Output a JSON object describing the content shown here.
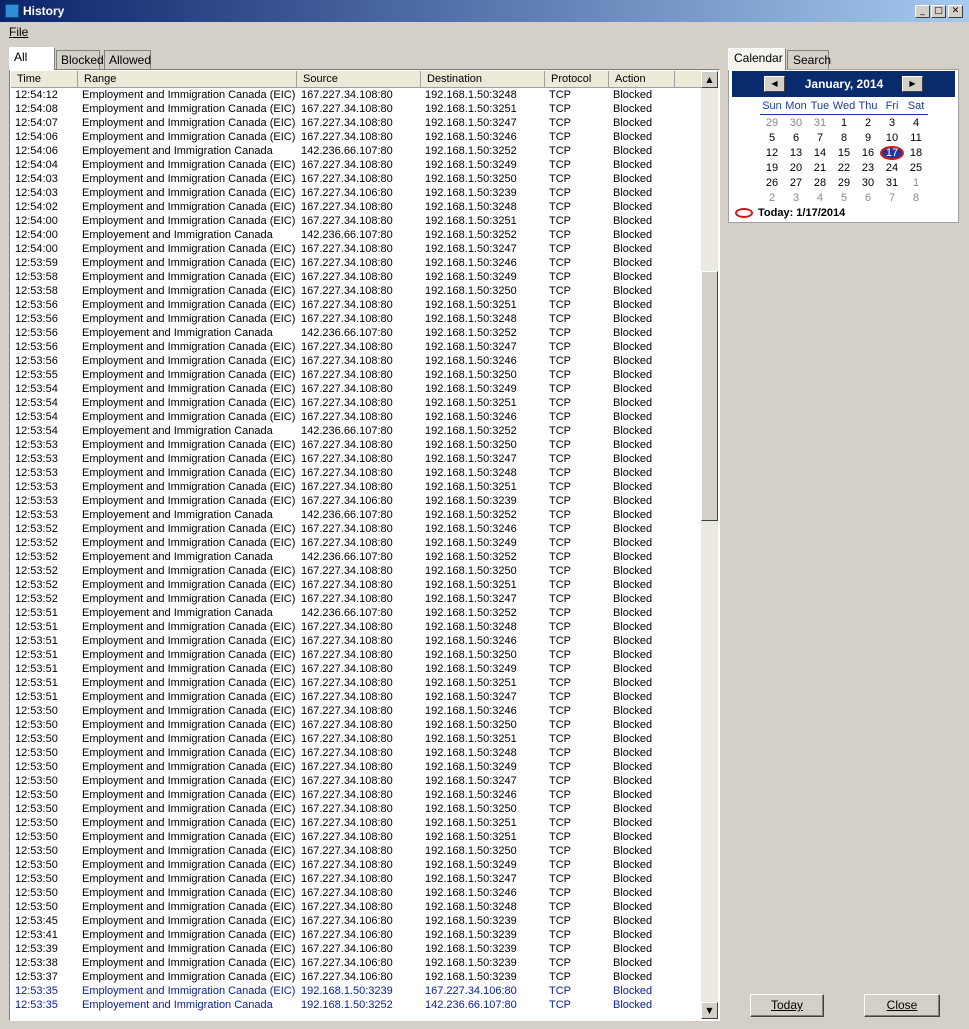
{
  "window": {
    "title": "History"
  },
  "menu": {
    "file": "File"
  },
  "tabs": [
    {
      "label": "All"
    },
    {
      "label": "Blocked"
    },
    {
      "label": "Allowed"
    }
  ],
  "columns": [
    "Time",
    "Range",
    "Source",
    "Destination",
    "Protocol",
    "Action"
  ],
  "rows": [
    {
      "time": "12:54:12",
      "range": "Employment and Immigration Canada (EIC)",
      "source": "167.227.34.108:80",
      "destination": "192.168.1.50:3248",
      "protocol": "TCP",
      "action": "Blocked"
    },
    {
      "time": "12:54:08",
      "range": "Employment and Immigration Canada (EIC)",
      "source": "167.227.34.108:80",
      "destination": "192.168.1.50:3251",
      "protocol": "TCP",
      "action": "Blocked"
    },
    {
      "time": "12:54:07",
      "range": "Employment and Immigration Canada (EIC)",
      "source": "167.227.34.108:80",
      "destination": "192.168.1.50:3247",
      "protocol": "TCP",
      "action": "Blocked"
    },
    {
      "time": "12:54:06",
      "range": "Employment and Immigration Canada (EIC)",
      "source": "167.227.34.108:80",
      "destination": "192.168.1.50:3246",
      "protocol": "TCP",
      "action": "Blocked"
    },
    {
      "time": "12:54:06",
      "range": "Employement and Immigration Canada",
      "source": "142.236.66.107:80",
      "destination": "192.168.1.50:3252",
      "protocol": "TCP",
      "action": "Blocked"
    },
    {
      "time": "12:54:04",
      "range": "Employment and Immigration Canada (EIC)",
      "source": "167.227.34.108:80",
      "destination": "192.168.1.50:3249",
      "protocol": "TCP",
      "action": "Blocked"
    },
    {
      "time": "12:54:03",
      "range": "Employment and Immigration Canada (EIC)",
      "source": "167.227.34.108:80",
      "destination": "192.168.1.50:3250",
      "protocol": "TCP",
      "action": "Blocked"
    },
    {
      "time": "12:54:03",
      "range": "Employment and Immigration Canada (EIC)",
      "source": "167.227.34.106:80",
      "destination": "192.168.1.50:3239",
      "protocol": "TCP",
      "action": "Blocked"
    },
    {
      "time": "12:54:02",
      "range": "Employment and Immigration Canada (EIC)",
      "source": "167.227.34.108:80",
      "destination": "192.168.1.50:3248",
      "protocol": "TCP",
      "action": "Blocked"
    },
    {
      "time": "12:54:00",
      "range": "Employment and Immigration Canada (EIC)",
      "source": "167.227.34.108:80",
      "destination": "192.168.1.50:3251",
      "protocol": "TCP",
      "action": "Blocked"
    },
    {
      "time": "12:54:00",
      "range": "Employement and Immigration Canada",
      "source": "142.236.66.107:80",
      "destination": "192.168.1.50:3252",
      "protocol": "TCP",
      "action": "Blocked"
    },
    {
      "time": "12:54:00",
      "range": "Employment and Immigration Canada (EIC)",
      "source": "167.227.34.108:80",
      "destination": "192.168.1.50:3247",
      "protocol": "TCP",
      "action": "Blocked"
    },
    {
      "time": "12:53:59",
      "range": "Employment and Immigration Canada (EIC)",
      "source": "167.227.34.108:80",
      "destination": "192.168.1.50:3246",
      "protocol": "TCP",
      "action": "Blocked"
    },
    {
      "time": "12:53:58",
      "range": "Employment and Immigration Canada (EIC)",
      "source": "167.227.34.108:80",
      "destination": "192.168.1.50:3249",
      "protocol": "TCP",
      "action": "Blocked"
    },
    {
      "time": "12:53:58",
      "range": "Employment and Immigration Canada (EIC)",
      "source": "167.227.34.108:80",
      "destination": "192.168.1.50:3250",
      "protocol": "TCP",
      "action": "Blocked"
    },
    {
      "time": "12:53:56",
      "range": "Employment and Immigration Canada (EIC)",
      "source": "167.227.34.108:80",
      "destination": "192.168.1.50:3251",
      "protocol": "TCP",
      "action": "Blocked"
    },
    {
      "time": "12:53:56",
      "range": "Employment and Immigration Canada (EIC)",
      "source": "167.227.34.108:80",
      "destination": "192.168.1.50:3248",
      "protocol": "TCP",
      "action": "Blocked"
    },
    {
      "time": "12:53:56",
      "range": "Employement and Immigration Canada",
      "source": "142.236.66.107:80",
      "destination": "192.168.1.50:3252",
      "protocol": "TCP",
      "action": "Blocked"
    },
    {
      "time": "12:53:56",
      "range": "Employment and Immigration Canada (EIC)",
      "source": "167.227.34.108:80",
      "destination": "192.168.1.50:3247",
      "protocol": "TCP",
      "action": "Blocked"
    },
    {
      "time": "12:53:56",
      "range": "Employment and Immigration Canada (EIC)",
      "source": "167.227.34.108:80",
      "destination": "192.168.1.50:3246",
      "protocol": "TCP",
      "action": "Blocked"
    },
    {
      "time": "12:53:55",
      "range": "Employment and Immigration Canada (EIC)",
      "source": "167.227.34.108:80",
      "destination": "192.168.1.50:3250",
      "protocol": "TCP",
      "action": "Blocked"
    },
    {
      "time": "12:53:54",
      "range": "Employment and Immigration Canada (EIC)",
      "source": "167.227.34.108:80",
      "destination": "192.168.1.50:3249",
      "protocol": "TCP",
      "action": "Blocked"
    },
    {
      "time": "12:53:54",
      "range": "Employment and Immigration Canada (EIC)",
      "source": "167.227.34.108:80",
      "destination": "192.168.1.50:3251",
      "protocol": "TCP",
      "action": "Blocked"
    },
    {
      "time": "12:53:54",
      "range": "Employment and Immigration Canada (EIC)",
      "source": "167.227.34.108:80",
      "destination": "192.168.1.50:3246",
      "protocol": "TCP",
      "action": "Blocked"
    },
    {
      "time": "12:53:54",
      "range": "Employement and Immigration Canada",
      "source": "142.236.66.107:80",
      "destination": "192.168.1.50:3252",
      "protocol": "TCP",
      "action": "Blocked"
    },
    {
      "time": "12:53:53",
      "range": "Employment and Immigration Canada (EIC)",
      "source": "167.227.34.108:80",
      "destination": "192.168.1.50:3250",
      "protocol": "TCP",
      "action": "Blocked"
    },
    {
      "time": "12:53:53",
      "range": "Employment and Immigration Canada (EIC)",
      "source": "167.227.34.108:80",
      "destination": "192.168.1.50:3247",
      "protocol": "TCP",
      "action": "Blocked"
    },
    {
      "time": "12:53:53",
      "range": "Employment and Immigration Canada (EIC)",
      "source": "167.227.34.108:80",
      "destination": "192.168.1.50:3248",
      "protocol": "TCP",
      "action": "Blocked"
    },
    {
      "time": "12:53:53",
      "range": "Employment and Immigration Canada (EIC)",
      "source": "167.227.34.108:80",
      "destination": "192.168.1.50:3251",
      "protocol": "TCP",
      "action": "Blocked"
    },
    {
      "time": "12:53:53",
      "range": "Employment and Immigration Canada (EIC)",
      "source": "167.227.34.106:80",
      "destination": "192.168.1.50:3239",
      "protocol": "TCP",
      "action": "Blocked"
    },
    {
      "time": "12:53:53",
      "range": "Employement and Immigration Canada",
      "source": "142.236.66.107:80",
      "destination": "192.168.1.50:3252",
      "protocol": "TCP",
      "action": "Blocked"
    },
    {
      "time": "12:53:52",
      "range": "Employment and Immigration Canada (EIC)",
      "source": "167.227.34.108:80",
      "destination": "192.168.1.50:3246",
      "protocol": "TCP",
      "action": "Blocked"
    },
    {
      "time": "12:53:52",
      "range": "Employment and Immigration Canada (EIC)",
      "source": "167.227.34.108:80",
      "destination": "192.168.1.50:3249",
      "protocol": "TCP",
      "action": "Blocked"
    },
    {
      "time": "12:53:52",
      "range": "Employement and Immigration Canada",
      "source": "142.236.66.107:80",
      "destination": "192.168.1.50:3252",
      "protocol": "TCP",
      "action": "Blocked"
    },
    {
      "time": "12:53:52",
      "range": "Employment and Immigration Canada (EIC)",
      "source": "167.227.34.108:80",
      "destination": "192.168.1.50:3250",
      "protocol": "TCP",
      "action": "Blocked"
    },
    {
      "time": "12:53:52",
      "range": "Employment and Immigration Canada (EIC)",
      "source": "167.227.34.108:80",
      "destination": "192.168.1.50:3251",
      "protocol": "TCP",
      "action": "Blocked"
    },
    {
      "time": "12:53:52",
      "range": "Employment and Immigration Canada (EIC)",
      "source": "167.227.34.108:80",
      "destination": "192.168.1.50:3247",
      "protocol": "TCP",
      "action": "Blocked"
    },
    {
      "time": "12:53:51",
      "range": "Employement and Immigration Canada",
      "source": "142.236.66.107:80",
      "destination": "192.168.1.50:3252",
      "protocol": "TCP",
      "action": "Blocked"
    },
    {
      "time": "12:53:51",
      "range": "Employment and Immigration Canada (EIC)",
      "source": "167.227.34.108:80",
      "destination": "192.168.1.50:3248",
      "protocol": "TCP",
      "action": "Blocked"
    },
    {
      "time": "12:53:51",
      "range": "Employment and Immigration Canada (EIC)",
      "source": "167.227.34.108:80",
      "destination": "192.168.1.50:3246",
      "protocol": "TCP",
      "action": "Blocked"
    },
    {
      "time": "12:53:51",
      "range": "Employment and Immigration Canada (EIC)",
      "source": "167.227.34.108:80",
      "destination": "192.168.1.50:3250",
      "protocol": "TCP",
      "action": "Blocked"
    },
    {
      "time": "12:53:51",
      "range": "Employment and Immigration Canada (EIC)",
      "source": "167.227.34.108:80",
      "destination": "192.168.1.50:3249",
      "protocol": "TCP",
      "action": "Blocked"
    },
    {
      "time": "12:53:51",
      "range": "Employment and Immigration Canada (EIC)",
      "source": "167.227.34.108:80",
      "destination": "192.168.1.50:3251",
      "protocol": "TCP",
      "action": "Blocked"
    },
    {
      "time": "12:53:51",
      "range": "Employment and Immigration Canada (EIC)",
      "source": "167.227.34.108:80",
      "destination": "192.168.1.50:3247",
      "protocol": "TCP",
      "action": "Blocked"
    },
    {
      "time": "12:53:50",
      "range": "Employment and Immigration Canada (EIC)",
      "source": "167.227.34.108:80",
      "destination": "192.168.1.50:3246",
      "protocol": "TCP",
      "action": "Blocked"
    },
    {
      "time": "12:53:50",
      "range": "Employment and Immigration Canada (EIC)",
      "source": "167.227.34.108:80",
      "destination": "192.168.1.50:3250",
      "protocol": "TCP",
      "action": "Blocked"
    },
    {
      "time": "12:53:50",
      "range": "Employment and Immigration Canada (EIC)",
      "source": "167.227.34.108:80",
      "destination": "192.168.1.50:3251",
      "protocol": "TCP",
      "action": "Blocked"
    },
    {
      "time": "12:53:50",
      "range": "Employment and Immigration Canada (EIC)",
      "source": "167.227.34.108:80",
      "destination": "192.168.1.50:3248",
      "protocol": "TCP",
      "action": "Blocked"
    },
    {
      "time": "12:53:50",
      "range": "Employment and Immigration Canada (EIC)",
      "source": "167.227.34.108:80",
      "destination": "192.168.1.50:3249",
      "protocol": "TCP",
      "action": "Blocked"
    },
    {
      "time": "12:53:50",
      "range": "Employment and Immigration Canada (EIC)",
      "source": "167.227.34.108:80",
      "destination": "192.168.1.50:3247",
      "protocol": "TCP",
      "action": "Blocked"
    },
    {
      "time": "12:53:50",
      "range": "Employment and Immigration Canada (EIC)",
      "source": "167.227.34.108:80",
      "destination": "192.168.1.50:3246",
      "protocol": "TCP",
      "action": "Blocked"
    },
    {
      "time": "12:53:50",
      "range": "Employment and Immigration Canada (EIC)",
      "source": "167.227.34.108:80",
      "destination": "192.168.1.50:3250",
      "protocol": "TCP",
      "action": "Blocked"
    },
    {
      "time": "12:53:50",
      "range": "Employment and Immigration Canada (EIC)",
      "source": "167.227.34.108:80",
      "destination": "192.168.1.50:3251",
      "protocol": "TCP",
      "action": "Blocked"
    },
    {
      "time": "12:53:50",
      "range": "Employment and Immigration Canada (EIC)",
      "source": "167.227.34.108:80",
      "destination": "192.168.1.50:3251",
      "protocol": "TCP",
      "action": "Blocked"
    },
    {
      "time": "12:53:50",
      "range": "Employment and Immigration Canada (EIC)",
      "source": "167.227.34.108:80",
      "destination": "192.168.1.50:3250",
      "protocol": "TCP",
      "action": "Blocked"
    },
    {
      "time": "12:53:50",
      "range": "Employment and Immigration Canada (EIC)",
      "source": "167.227.34.108:80",
      "destination": "192.168.1.50:3249",
      "protocol": "TCP",
      "action": "Blocked"
    },
    {
      "time": "12:53:50",
      "range": "Employment and Immigration Canada (EIC)",
      "source": "167.227.34.108:80",
      "destination": "192.168.1.50:3247",
      "protocol": "TCP",
      "action": "Blocked"
    },
    {
      "time": "12:53:50",
      "range": "Employment and Immigration Canada (EIC)",
      "source": "167.227.34.108:80",
      "destination": "192.168.1.50:3246",
      "protocol": "TCP",
      "action": "Blocked"
    },
    {
      "time": "12:53:50",
      "range": "Employment and Immigration Canada (EIC)",
      "source": "167.227.34.108:80",
      "destination": "192.168.1.50:3248",
      "protocol": "TCP",
      "action": "Blocked"
    },
    {
      "time": "12:53:45",
      "range": "Employment and Immigration Canada (EIC)",
      "source": "167.227.34.106:80",
      "destination": "192.168.1.50:3239",
      "protocol": "TCP",
      "action": "Blocked"
    },
    {
      "time": "12:53:41",
      "range": "Employment and Immigration Canada (EIC)",
      "source": "167.227.34.106:80",
      "destination": "192.168.1.50:3239",
      "protocol": "TCP",
      "action": "Blocked"
    },
    {
      "time": "12:53:39",
      "range": "Employment and Immigration Canada (EIC)",
      "source": "167.227.34.106:80",
      "destination": "192.168.1.50:3239",
      "protocol": "TCP",
      "action": "Blocked"
    },
    {
      "time": "12:53:38",
      "range": "Employment and Immigration Canada (EIC)",
      "source": "167.227.34.106:80",
      "destination": "192.168.1.50:3239",
      "protocol": "TCP",
      "action": "Blocked"
    },
    {
      "time": "12:53:37",
      "range": "Employment and Immigration Canada (EIC)",
      "source": "167.227.34.106:80",
      "destination": "192.168.1.50:3239",
      "protocol": "TCP",
      "action": "Blocked"
    },
    {
      "time": "12:53:35",
      "range": "Employment and Immigration Canada (EIC)",
      "source": "192.168.1.50:3239",
      "destination": "167.227.34.106:80",
      "protocol": "TCP",
      "action": "Blocked",
      "outbound": true
    },
    {
      "time": "12:53:35",
      "range": "Employement and Immigration Canada",
      "source": "192.168.1.50:3252",
      "destination": "142.236.66.107:80",
      "protocol": "TCP",
      "action": "Blocked",
      "outbound": true
    }
  ],
  "right_tabs": [
    {
      "label": "Calendar"
    },
    {
      "label": "Search"
    }
  ],
  "calendar": {
    "month_title": "January, 2014",
    "day_names": [
      "Sun",
      "Mon",
      "Tue",
      "Wed",
      "Thu",
      "Fri",
      "Sat"
    ],
    "weeks": [
      [
        "29",
        "30",
        "31",
        "1",
        "2",
        "3",
        "4"
      ],
      [
        "5",
        "6",
        "7",
        "8",
        "9",
        "10",
        "11"
      ],
      [
        "12",
        "13",
        "14",
        "15",
        "16",
        "17",
        "18"
      ],
      [
        "19",
        "20",
        "21",
        "22",
        "23",
        "24",
        "25"
      ],
      [
        "26",
        "27",
        "28",
        "29",
        "30",
        "31",
        "1"
      ],
      [
        "2",
        "3",
        "4",
        "5",
        "6",
        "7",
        "8"
      ]
    ],
    "today_day": "17",
    "today_label": "Today: 1/17/2014"
  },
  "buttons": {
    "today": "Today",
    "close": "Close"
  },
  "colors": {
    "outbound_row": "#0b209d",
    "titlebar": "#0a246a",
    "calendar_header": "#0a2a6e",
    "today_ring": "#d01a1a"
  }
}
